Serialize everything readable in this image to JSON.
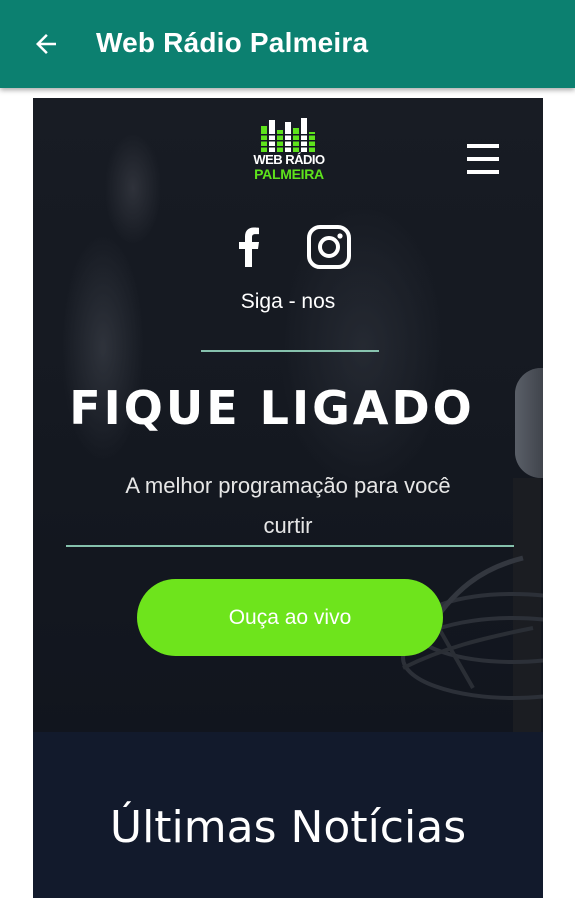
{
  "appbar": {
    "title": "Web Rádio Palmeira",
    "back_icon": "arrow-left-icon",
    "background": "#0c8070"
  },
  "site": {
    "logo": {
      "line1": "WEB RÁDIO",
      "line2": "PALMEIRA",
      "accent": "#5ee31c"
    },
    "menu_icon": "hamburger-icon",
    "social": {
      "facebook_icon": "facebook-icon",
      "instagram_icon": "instagram-icon",
      "follow_text": "Siga - nos"
    },
    "hero": {
      "title": "FIQUE LIGADO",
      "subtitle": "A melhor programação para você curtir",
      "button_label": "Ouça ao vivo",
      "button_color": "#6ee41c"
    },
    "news": {
      "title": "Últimas Notícias"
    }
  }
}
